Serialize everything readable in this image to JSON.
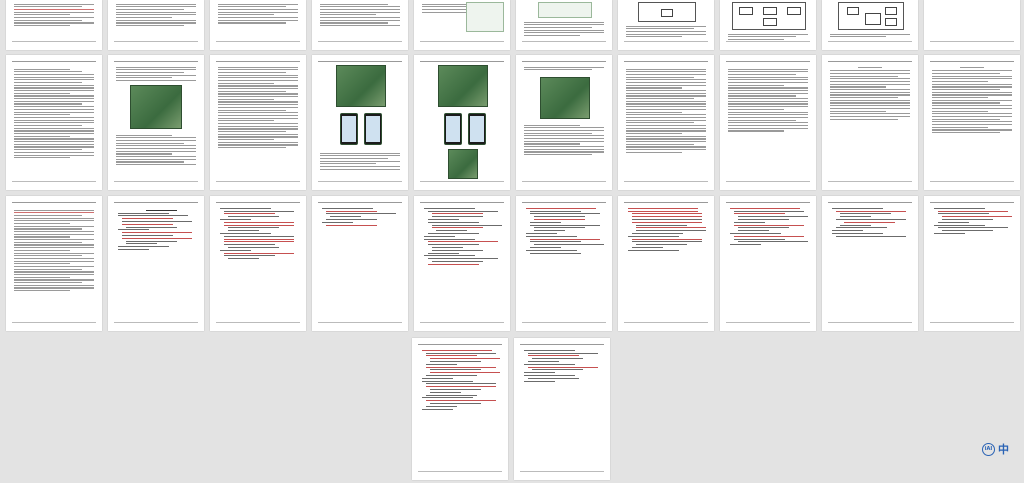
{
  "viewer": {
    "language_badge": "中",
    "badge_logo_text": "iAI"
  },
  "pages": [
    {
      "row": 1,
      "col": 1,
      "kind": "text"
    },
    {
      "row": 1,
      "col": 2,
      "kind": "text"
    },
    {
      "row": 1,
      "col": 3,
      "kind": "text"
    },
    {
      "row": 1,
      "col": 4,
      "kind": "text"
    },
    {
      "row": 1,
      "col": 5,
      "kind": "text"
    },
    {
      "row": 1,
      "col": 6,
      "kind": "screenshot"
    },
    {
      "row": 1,
      "col": 7,
      "kind": "diagram"
    },
    {
      "row": 1,
      "col": 8,
      "kind": "diagram"
    },
    {
      "row": 1,
      "col": 9,
      "kind": "blank"
    },
    {
      "row": 2,
      "col": 1,
      "kind": "text"
    },
    {
      "row": 2,
      "col": 2,
      "kind": "photo"
    },
    {
      "row": 2,
      "col": 3,
      "kind": "photo"
    },
    {
      "row": 2,
      "col": 4,
      "kind": "photo"
    },
    {
      "row": 2,
      "col": 5,
      "kind": "photo"
    },
    {
      "row": 2,
      "col": 6,
      "kind": "photo"
    },
    {
      "row": 2,
      "col": 7,
      "kind": "text"
    },
    {
      "row": 2,
      "col": 8,
      "kind": "text"
    },
    {
      "row": 2,
      "col": 9,
      "kind": "text"
    },
    {
      "row": 2,
      "col": 10,
      "kind": "text"
    },
    {
      "row": 3,
      "col": 1,
      "kind": "references"
    },
    {
      "row": 3,
      "col": 2,
      "kind": "code"
    },
    {
      "row": 3,
      "col": 3,
      "kind": "code"
    },
    {
      "row": 3,
      "col": 4,
      "kind": "code"
    },
    {
      "row": 3,
      "col": 5,
      "kind": "code"
    },
    {
      "row": 3,
      "col": 6,
      "kind": "code"
    },
    {
      "row": 3,
      "col": 7,
      "kind": "code"
    },
    {
      "row": 3,
      "col": 8,
      "kind": "code"
    },
    {
      "row": 3,
      "col": 9,
      "kind": "code"
    },
    {
      "row": 3,
      "col": 10,
      "kind": "code"
    },
    {
      "row": 4,
      "col": 1,
      "kind": "code"
    },
    {
      "row": 4,
      "col": 2,
      "kind": "code"
    }
  ]
}
